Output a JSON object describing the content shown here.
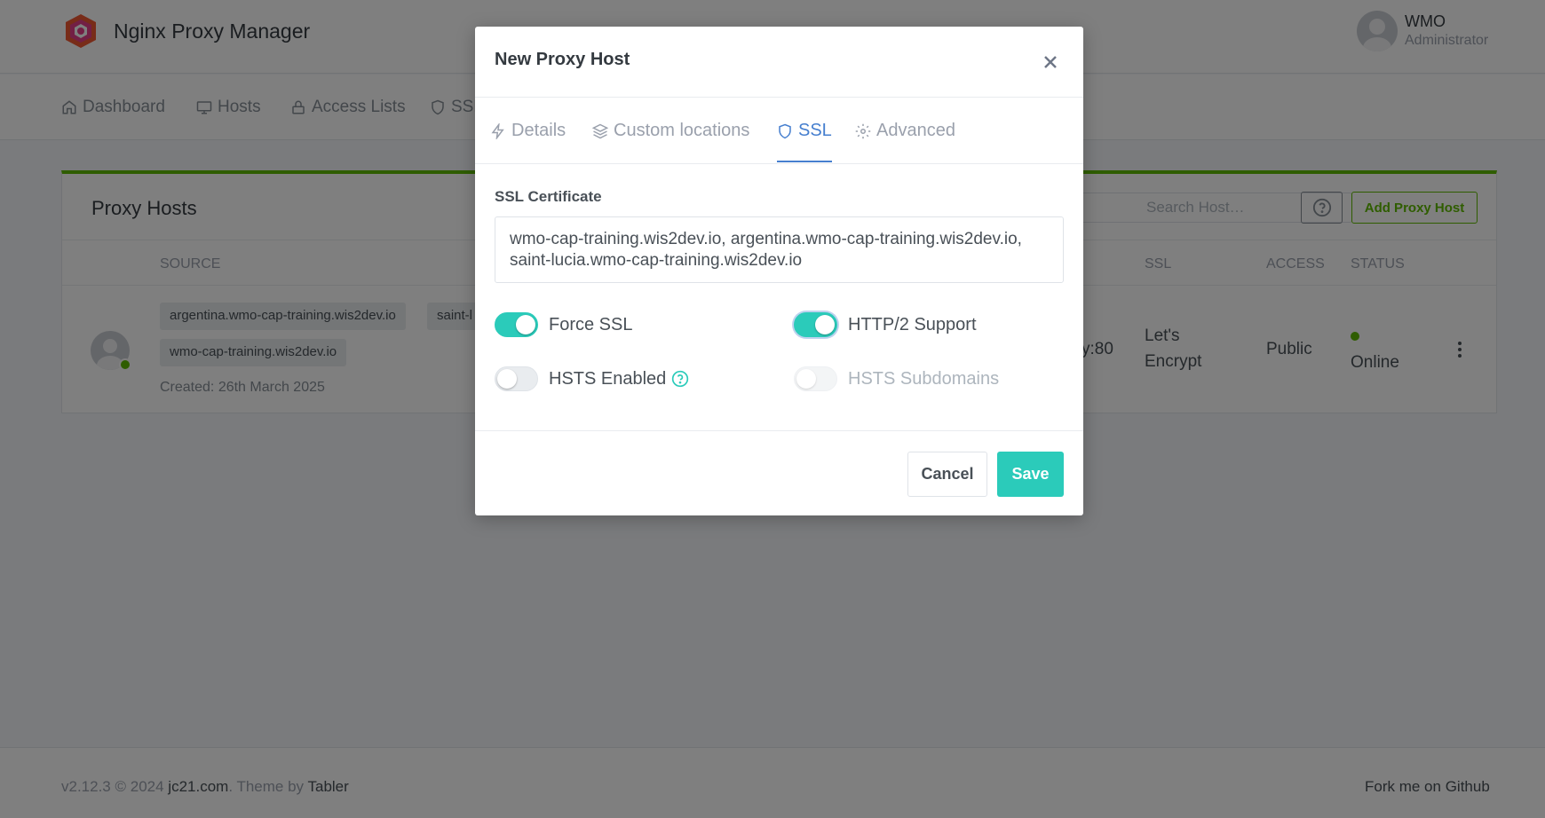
{
  "app": {
    "title": "Nginx Proxy Manager",
    "user_name": "WMO",
    "user_role": "Administrator"
  },
  "nav": {
    "items": [
      {
        "label": "Dashboard",
        "icon": "home-icon"
      },
      {
        "label": "Hosts",
        "icon": "monitor-icon"
      },
      {
        "label": "Access Lists",
        "icon": "lock-icon"
      },
      {
        "label": "SSL",
        "icon": "shield-icon"
      }
    ]
  },
  "proxy_hosts": {
    "title": "Proxy Hosts",
    "search_placeholder": "Search Host…",
    "add_button": "Add Proxy Host",
    "columns": [
      "SOURCE",
      "SSL",
      "ACCESS",
      "STATUS"
    ],
    "row": {
      "tags": [
        "argentina.wmo-cap-training.wis2dev.io",
        "saint-l",
        "wmo-cap-training.wis2dev.io"
      ],
      "created": "Created: 26th March 2025",
      "destination_fragment": "y:80",
      "ssl": "Let's Encrypt",
      "access": "Public",
      "status": "Online"
    }
  },
  "footer": {
    "version": "v2.12.3 © 2024",
    "link1": "jc21.com",
    "theme_by": ". Theme by",
    "link2": "Tabler",
    "github": "Fork me on Github"
  },
  "modal": {
    "title": "New Proxy Host",
    "tabs": [
      {
        "label": "Details",
        "icon": "bolt-icon"
      },
      {
        "label": "Custom locations",
        "icon": "layers-icon"
      },
      {
        "label": "SSL",
        "icon": "shield-icon",
        "active": true
      },
      {
        "label": "Advanced",
        "icon": "gear-icon"
      }
    ],
    "ssl_certificate_label": "SSL Certificate",
    "certificate_line1": "wmo-cap-training.wis2dev.io, argentina.wmo-cap-training.wis2dev.io,",
    "certificate_line2": "saint-lucia.wmo-cap-training.wis2dev.io",
    "toggles": {
      "force_ssl": {
        "label": "Force SSL",
        "on": true
      },
      "http2": {
        "label": "HTTP/2 Support",
        "on": true
      },
      "hsts": {
        "label": "HSTS Enabled",
        "on": false
      },
      "hsts_sub": {
        "label": "HSTS Subdomains",
        "on": false,
        "disabled": true
      }
    },
    "cancel": "Cancel",
    "save": "Save"
  },
  "colors": {
    "accent_teal": "#2bcbba",
    "tab_active": "#467fcf",
    "green": "#5eba00"
  }
}
